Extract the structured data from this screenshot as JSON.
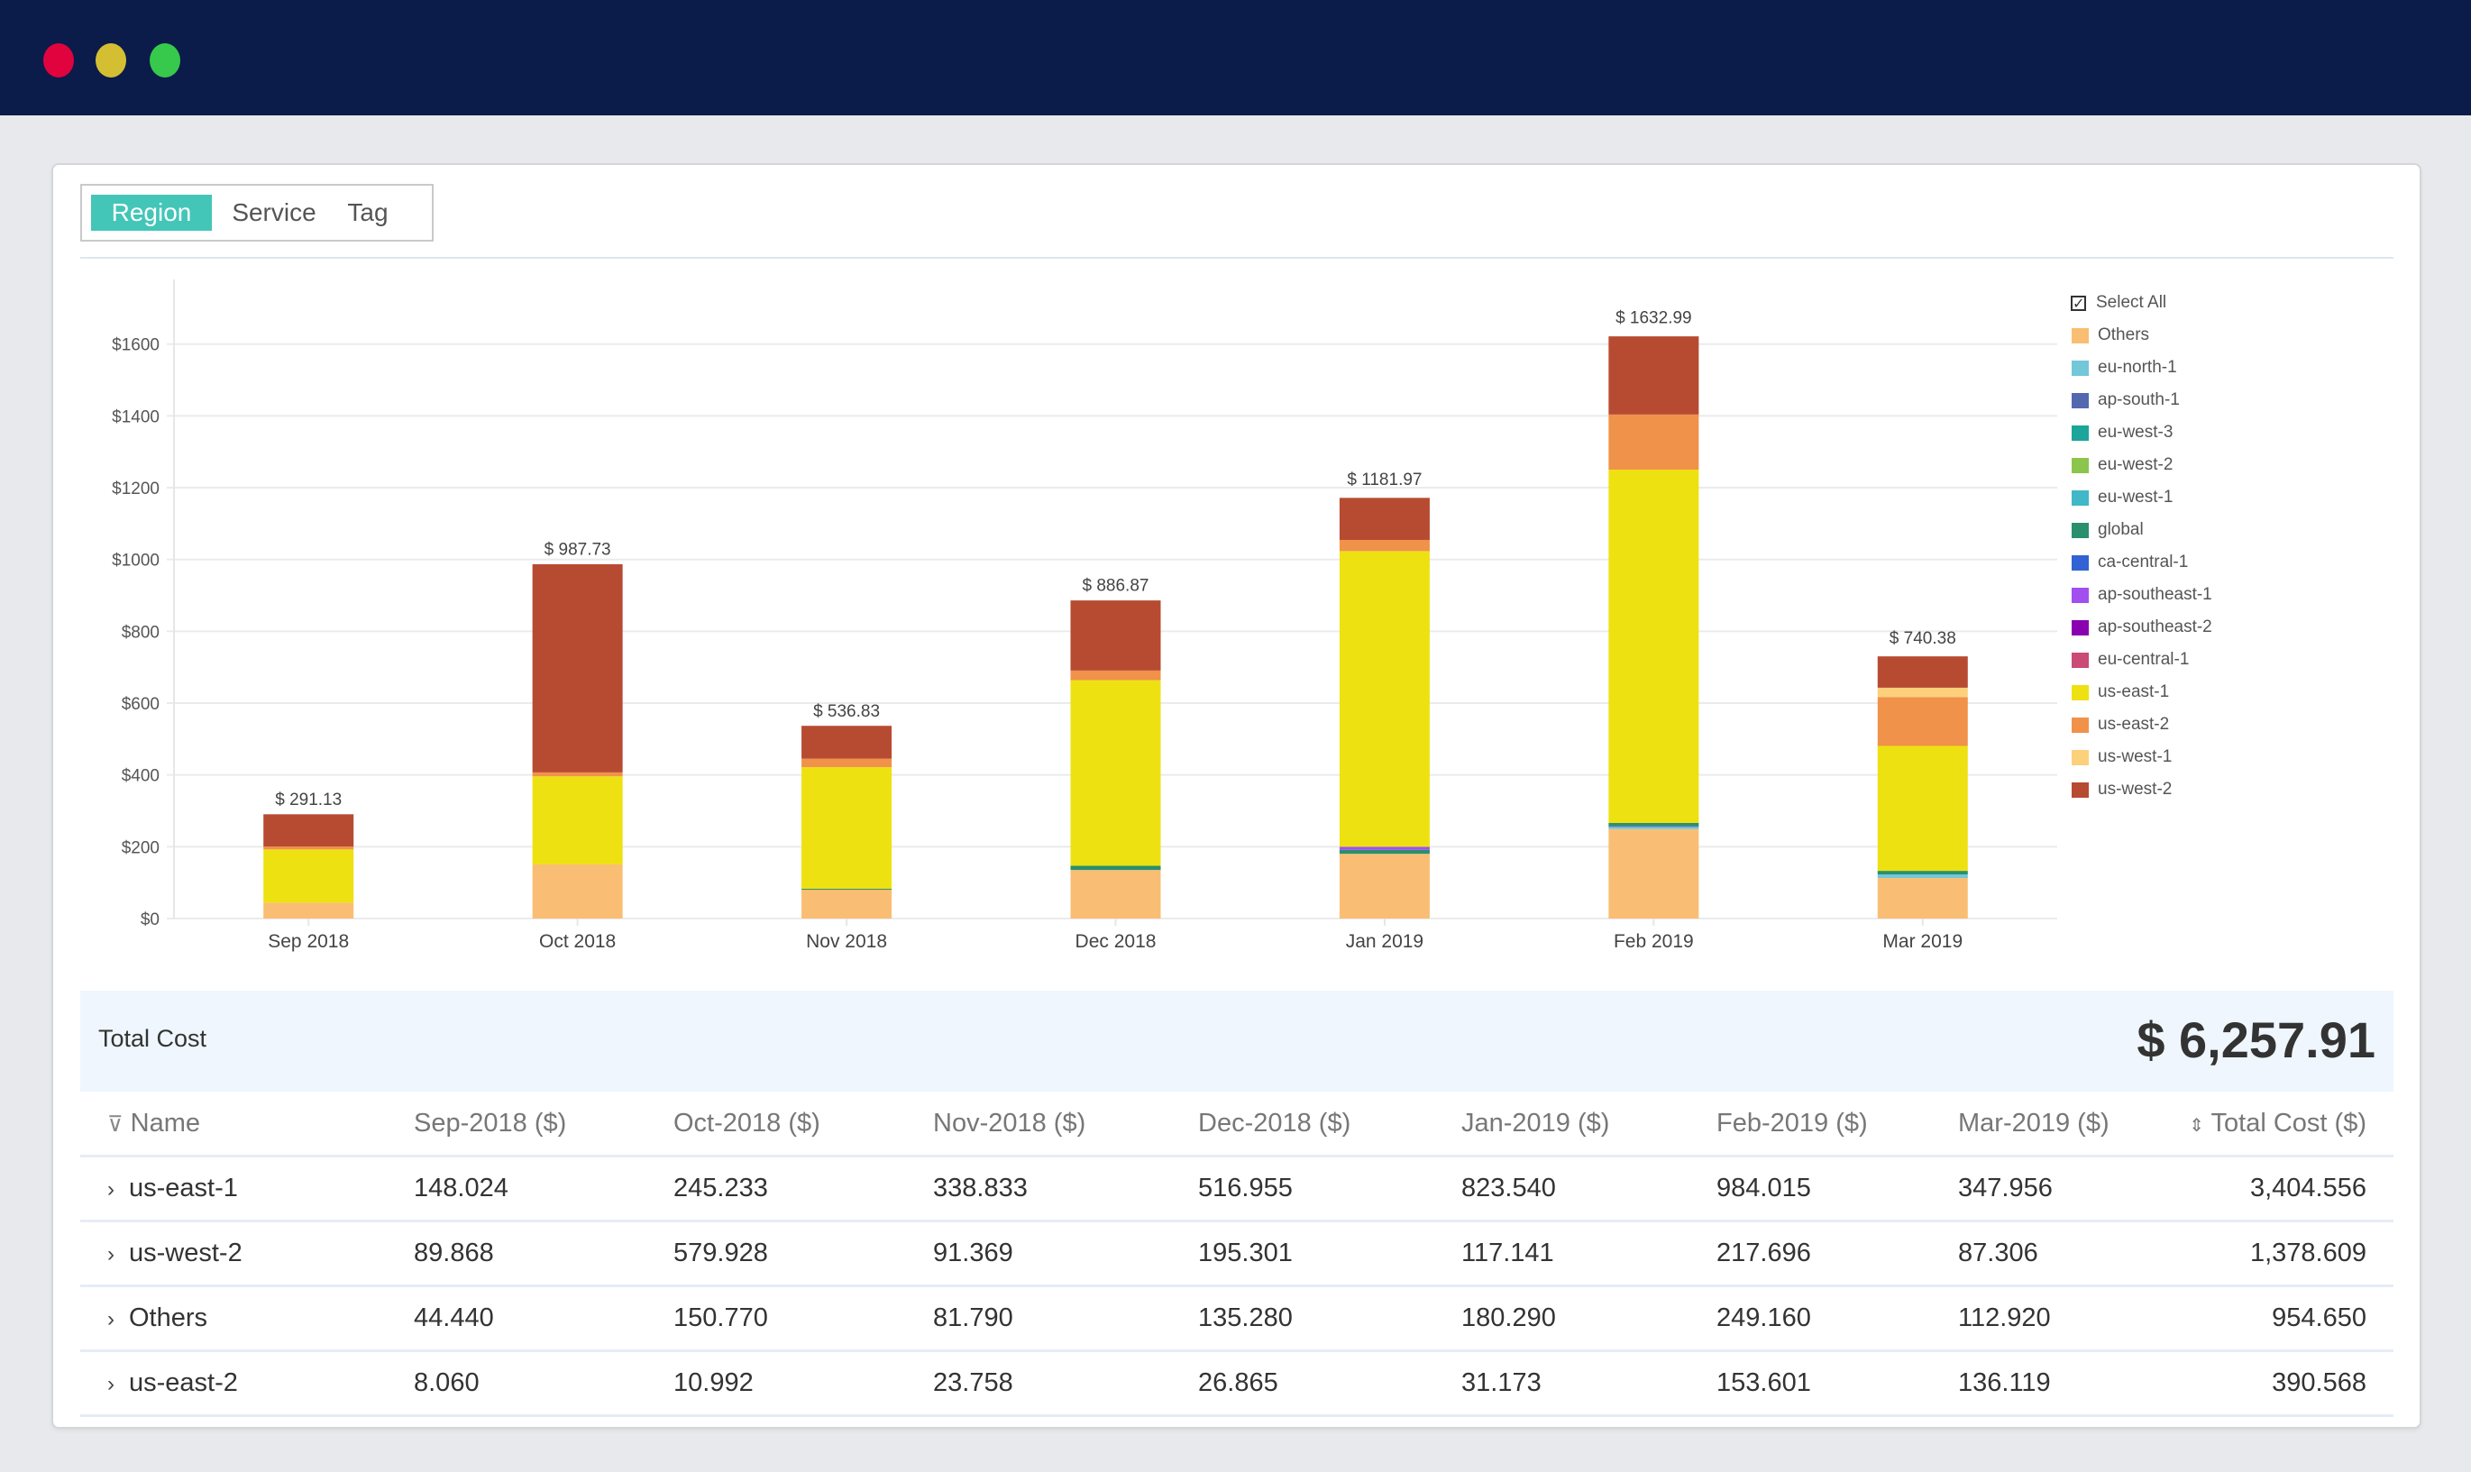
{
  "window": {
    "controls": [
      {
        "name": "close",
        "color": "#e0033e"
      },
      {
        "name": "minimize",
        "color": "#d4bf33"
      },
      {
        "name": "maximize",
        "color": "#36c94b"
      }
    ]
  },
  "tabs": [
    {
      "label": "Region",
      "active": true
    },
    {
      "label": "Service",
      "active": false
    },
    {
      "label": "Tag",
      "active": false
    }
  ],
  "legend": {
    "select_all_label": "Select All",
    "select_all_checked": true,
    "items": [
      {
        "label": "Others",
        "color": "#f9be73"
      },
      {
        "label": "eu-north-1",
        "color": "#72c7d9"
      },
      {
        "label": "ap-south-1",
        "color": "#5468b0"
      },
      {
        "label": "eu-west-3",
        "color": "#1ca59a"
      },
      {
        "label": "eu-west-2",
        "color": "#8cc54c"
      },
      {
        "label": "eu-west-1",
        "color": "#40b8c8"
      },
      {
        "label": "global",
        "color": "#2a8f6c"
      },
      {
        "label": "ca-central-1",
        "color": "#3262d4"
      },
      {
        "label": "ap-southeast-1",
        "color": "#a24ff0"
      },
      {
        "label": "ap-southeast-2",
        "color": "#8900b0"
      },
      {
        "label": "eu-central-1",
        "color": "#c94b76"
      },
      {
        "label": "us-east-1",
        "color": "#eee111"
      },
      {
        "label": "us-east-2",
        "color": "#f0924a"
      },
      {
        "label": "us-west-1",
        "color": "#fdd07c"
      },
      {
        "label": "us-west-2",
        "color": "#b74b31"
      }
    ]
  },
  "chart_data": {
    "type": "bar",
    "stacked": true,
    "title": "",
    "xlabel": "",
    "ylabel": "",
    "ylim": [
      0,
      1780
    ],
    "yticks": [
      0,
      200,
      400,
      600,
      800,
      1000,
      1200,
      1400,
      1600
    ],
    "ytick_labels": [
      "$0",
      "$200",
      "$400",
      "$600",
      "$800",
      "$1000",
      "$1200",
      "$1400",
      "$1600"
    ],
    "grid": true,
    "legend_position": "right",
    "categories": [
      "Sep 2018",
      "Oct 2018",
      "Nov 2018",
      "Dec 2018",
      "Jan 2019",
      "Feb 2019",
      "Mar 2019"
    ],
    "totals": [
      291.13,
      987.73,
      536.83,
      886.87,
      1181.97,
      1632.99,
      740.38
    ],
    "total_labels": [
      "$ 291.13",
      "$ 987.73",
      "$ 536.83",
      "$ 886.87",
      "$ 1181.97",
      "$ 1632.99",
      "$ 740.38"
    ],
    "series": [
      {
        "name": "Others",
        "values": [
          44.44,
          150.77,
          81.79,
          135.28,
          180.29,
          249.16,
          112.92
        ]
      },
      {
        "name": "eu-north-1",
        "values": [
          0,
          0,
          0,
          0,
          0,
          6,
          10
        ]
      },
      {
        "name": "ap-south-1",
        "values": [
          0,
          0,
          0,
          0,
          0,
          3,
          0
        ]
      },
      {
        "name": "global",
        "values": [
          0,
          0,
          1,
          11.6,
          11.2,
          8,
          9.9
        ]
      },
      {
        "name": "ap-southeast-1",
        "values": [
          0,
          0,
          0,
          0,
          8.3,
          0,
          0
        ]
      },
      {
        "name": "us-east-1",
        "values": [
          148.024,
          245.233,
          338.833,
          516.955,
          823.54,
          984.015,
          347.956
        ]
      },
      {
        "name": "us-east-2",
        "values": [
          8.06,
          10.992,
          23.758,
          26.865,
          31.173,
          153.601,
          136.119
        ]
      },
      {
        "name": "us-west-1",
        "values": [
          0,
          0,
          0,
          0,
          0,
          0,
          26
        ]
      },
      {
        "name": "us-west-2",
        "values": [
          89.868,
          579.928,
          91.369,
          195.301,
          117.141,
          217.696,
          87.306
        ]
      }
    ]
  },
  "summary": {
    "total_label": "Total Cost",
    "total_value": "$ 6,257.91"
  },
  "table": {
    "columns": [
      "Name",
      "Sep-2018 ($)",
      "Oct-2018 ($)",
      "Nov-2018 ($)",
      "Dec-2018 ($)",
      "Jan-2019 ($)",
      "Feb-2019 ($)",
      "Mar-2019 ($)",
      "Total Cost ($)"
    ],
    "rows": [
      {
        "name": "us-east-1",
        "values": [
          "148.024",
          "245.233",
          "338.833",
          "516.955",
          "823.540",
          "984.015",
          "347.956",
          "3,404.556"
        ]
      },
      {
        "name": "us-west-2",
        "values": [
          "89.868",
          "579.928",
          "91.369",
          "195.301",
          "117.141",
          "217.696",
          "87.306",
          "1,378.609"
        ]
      },
      {
        "name": "Others",
        "values": [
          "44.440",
          "150.770",
          "81.790",
          "135.280",
          "180.290",
          "249.160",
          "112.920",
          "954.650"
        ]
      },
      {
        "name": "us-east-2",
        "values": [
          "8.060",
          "10.992",
          "23.758",
          "26.865",
          "31.173",
          "153.601",
          "136.119",
          "390.568"
        ]
      }
    ]
  }
}
